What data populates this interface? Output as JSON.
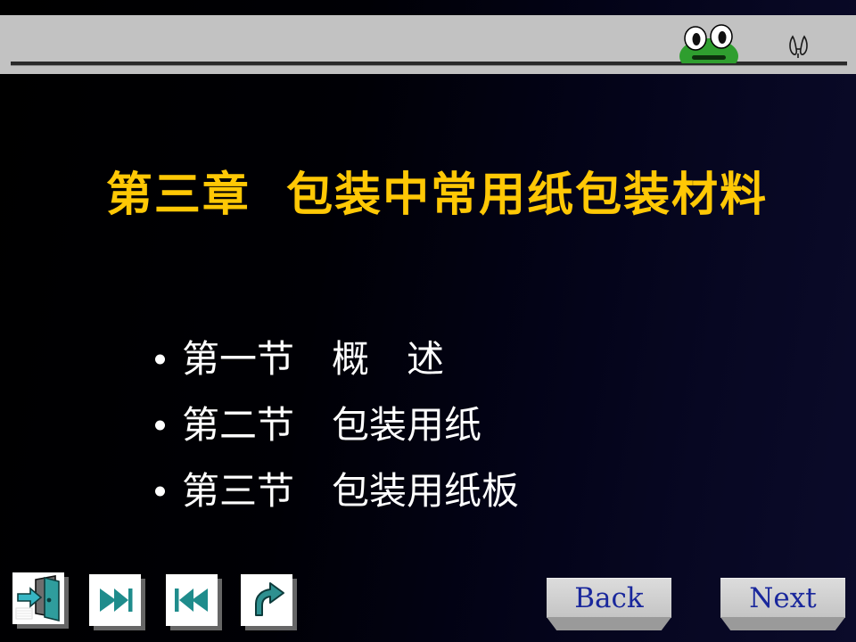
{
  "slide": {
    "title": "第三章  包装中常用纸包装材料",
    "title_color": "#ffc805",
    "background_left_color": "#000000",
    "background_right_color": "#0b0b2a",
    "header_band_color": "#c2c2c2"
  },
  "header": {
    "frog_icon": "frog-icon",
    "bird_mark_icon": "bird-footprint-icon"
  },
  "bullets": [
    {
      "text": "第一节　概　述"
    },
    {
      "text": "第二节　包装用纸"
    },
    {
      "text": "第三节　包装用纸板"
    }
  ],
  "toolbar": {
    "exit_icon": "exit-door-icon",
    "next_icon": "skip-forward-icon",
    "prev_icon": "skip-backward-icon",
    "return_icon": "return-arrow-icon",
    "icon_color": "#1f8c8c"
  },
  "navigation": {
    "back_label": "Back",
    "next_label": "Next",
    "label_color": "#19279c"
  }
}
